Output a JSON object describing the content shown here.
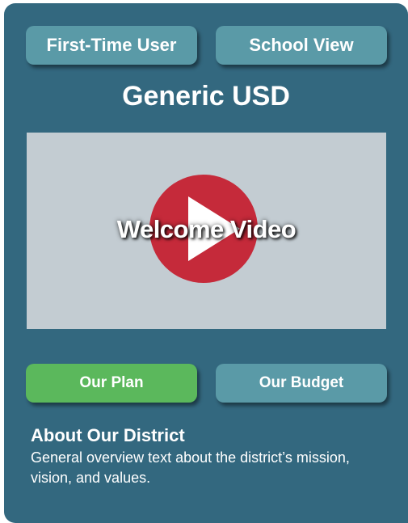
{
  "nav": {
    "first_time_user_label": "First-Time User",
    "school_view_label": "School View"
  },
  "district": {
    "name": "Generic USD"
  },
  "video": {
    "label": "Welcome Video",
    "icon": "play-icon"
  },
  "actions": {
    "plan_label": "Our Plan",
    "budget_label": "Our Budget"
  },
  "about": {
    "heading": "About Our District",
    "body": "General overview text about the district’s mission, vision, and values."
  },
  "colors": {
    "card_background": "#33687f",
    "button_teal": "#5a9aa7",
    "button_green": "#5bb85c",
    "video_placeholder": "#c3ccd2",
    "play_red": "#c52a3a"
  }
}
